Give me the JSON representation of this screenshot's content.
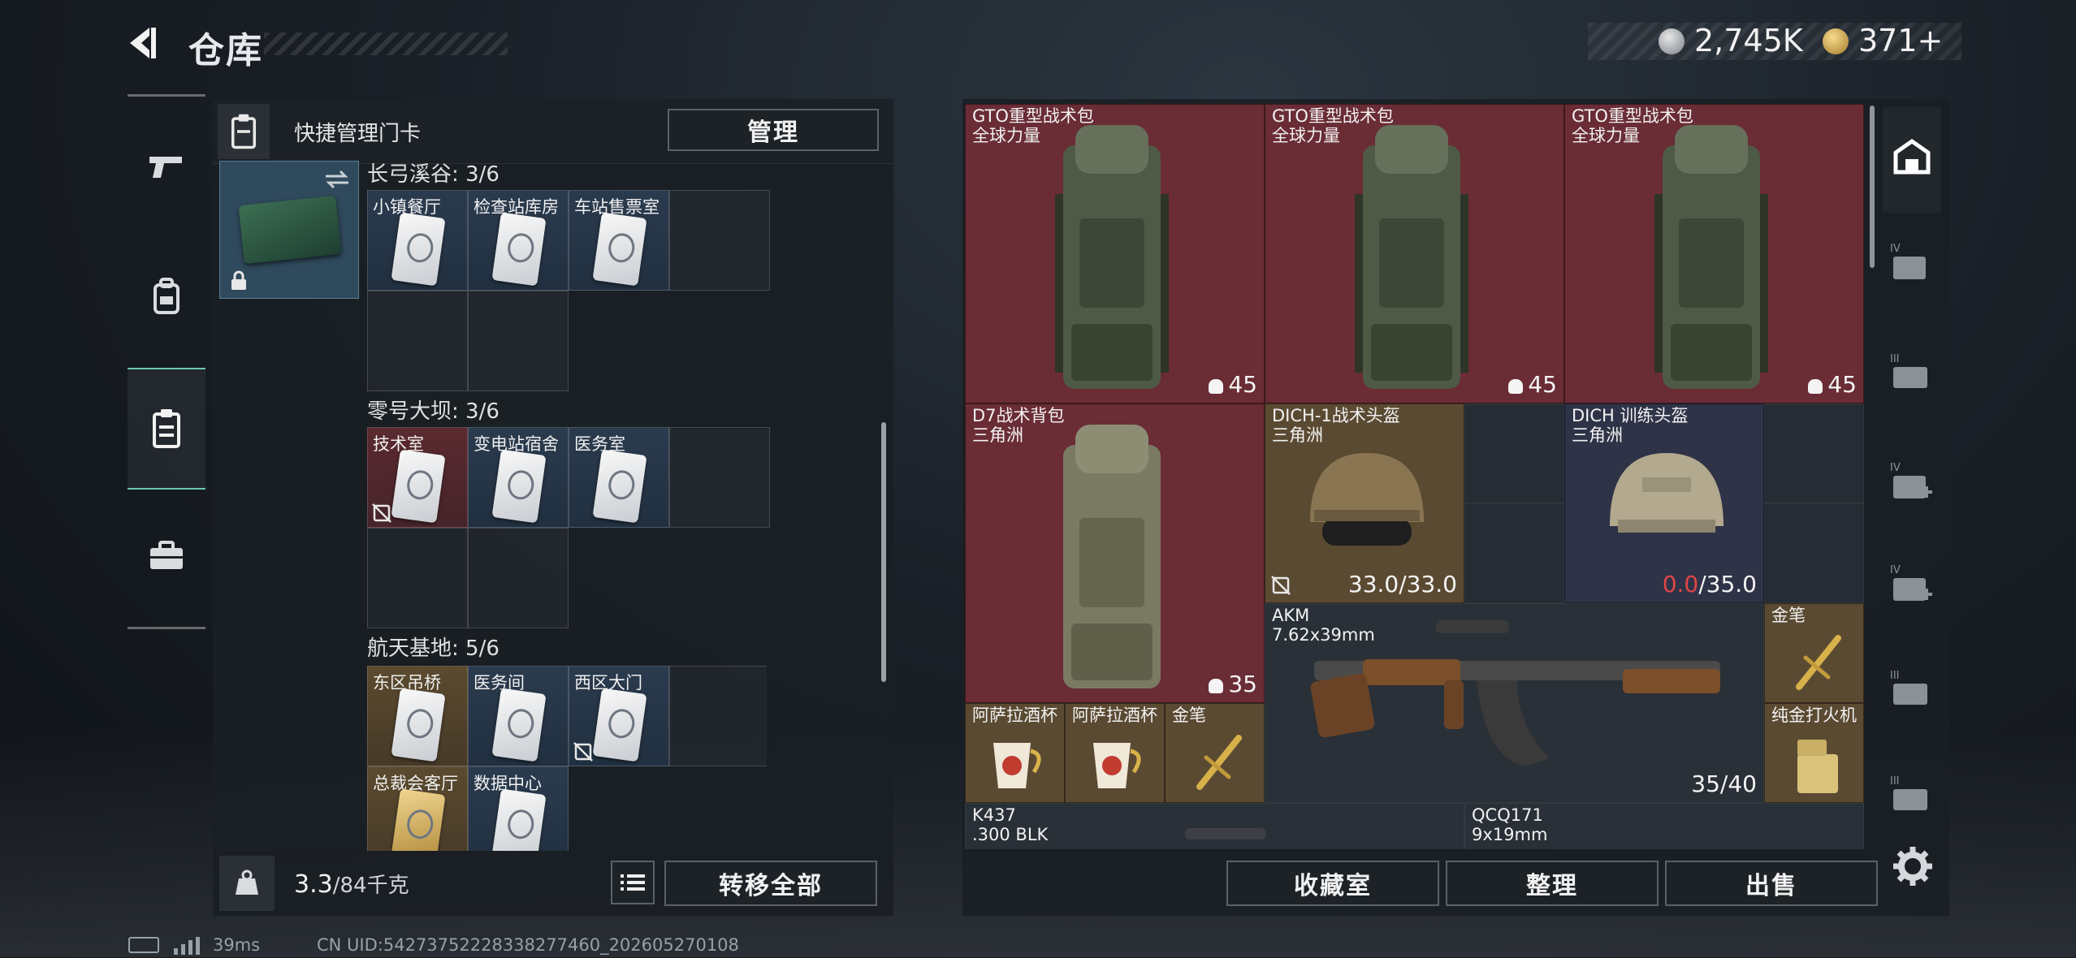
{
  "header": {
    "title": "仓库",
    "currency1": "2,745K",
    "currency2": "371+"
  },
  "left_panel": {
    "header_label": "快捷管理门卡",
    "manage_button": "管理",
    "sections": [
      {
        "title": "长弓溪谷: 3/6",
        "cards": [
          {
            "label": "小镇餐厅",
            "style": "blue",
            "has_card": true,
            "no_card_icon": false
          },
          {
            "label": "检查站库房",
            "style": "blue",
            "has_card": true,
            "no_card_icon": false
          },
          {
            "label": "车站售票室",
            "style": "blue",
            "has_card": true,
            "no_card_icon": false
          }
        ]
      },
      {
        "title": "零号大坝: 3/6",
        "cards": [
          {
            "label": "技术室",
            "style": "red",
            "has_card": true,
            "no_card_icon": true
          },
          {
            "label": "变电站宿舍",
            "style": "blue",
            "has_card": true,
            "no_card_icon": false
          },
          {
            "label": "医务室",
            "style": "blue",
            "has_card": true,
            "no_card_icon": false
          }
        ]
      },
      {
        "title": "航天基地: 5/6",
        "cards": [
          {
            "label": "东区吊桥",
            "style": "gold",
            "has_card": true,
            "no_card_icon": false
          },
          {
            "label": "医务间",
            "style": "blue",
            "has_card": true,
            "no_card_icon": false
          },
          {
            "label": "西区大门",
            "style": "blue",
            "has_card": true,
            "no_card_icon": true
          },
          {
            "label": "总裁会客厅",
            "style": "gold",
            "has_card": true,
            "no_card_icon": false,
            "gold_card": true
          },
          {
            "label": "数据中心",
            "style": "blue",
            "has_card": true,
            "no_card_icon": false
          }
        ]
      }
    ],
    "weight_value": "3.3",
    "weight_unit": "/84千克",
    "transfer_all_button": "转移全部"
  },
  "items": [
    {
      "name": "GTO重型战术包",
      "sub": "全球力量",
      "value": "45",
      "style": "red"
    },
    {
      "name": "GTO重型战术包",
      "sub": "全球力量",
      "value": "45",
      "style": "red"
    },
    {
      "name": "GTO重型战术包",
      "sub": "全球力量",
      "value": "45",
      "style": "red"
    },
    {
      "name": "D7战术背包",
      "sub": "三角洲",
      "value": "35",
      "style": "red"
    },
    {
      "name": "DICH-1战术头盔",
      "sub": "三角洲",
      "value": "33.0/33.0",
      "style": "tan"
    },
    {
      "name": "DICH 训练头盔",
      "sub": "三角洲",
      "value_low": "0.0",
      "value_max": "/35.0",
      "style": "navy"
    },
    {
      "name": "AKM",
      "sub": "7.62x39mm",
      "value": "35/40",
      "style": "dark"
    },
    {
      "name": "金笔",
      "style": "tan"
    },
    {
      "name": "纯金打火机",
      "style": "tan"
    },
    {
      "name": "阿萨拉酒杯",
      "style": "tan"
    },
    {
      "name": "阿萨拉酒杯",
      "style": "tan"
    },
    {
      "name": "金笔",
      "style": "tan"
    },
    {
      "name": "K437",
      "sub": ".300 BLK",
      "style": "dark"
    },
    {
      "name": "QCQ171",
      "sub": "9x19mm",
      "style": "dark"
    }
  ],
  "right_footer": {
    "collection_button": "收藏室",
    "sort_button": "整理",
    "sell_button": "出售"
  },
  "status_bar": {
    "ping": "39ms",
    "uid": "CN UID:5427375222833827746​0_202605270108"
  },
  "colors": {
    "accent": "#6ac8b2",
    "red_rarity": "#6a2c35",
    "gold_rarity": "#5b4a32",
    "blue_rarity": "#2f3347",
    "danger_text": "#e04646"
  }
}
